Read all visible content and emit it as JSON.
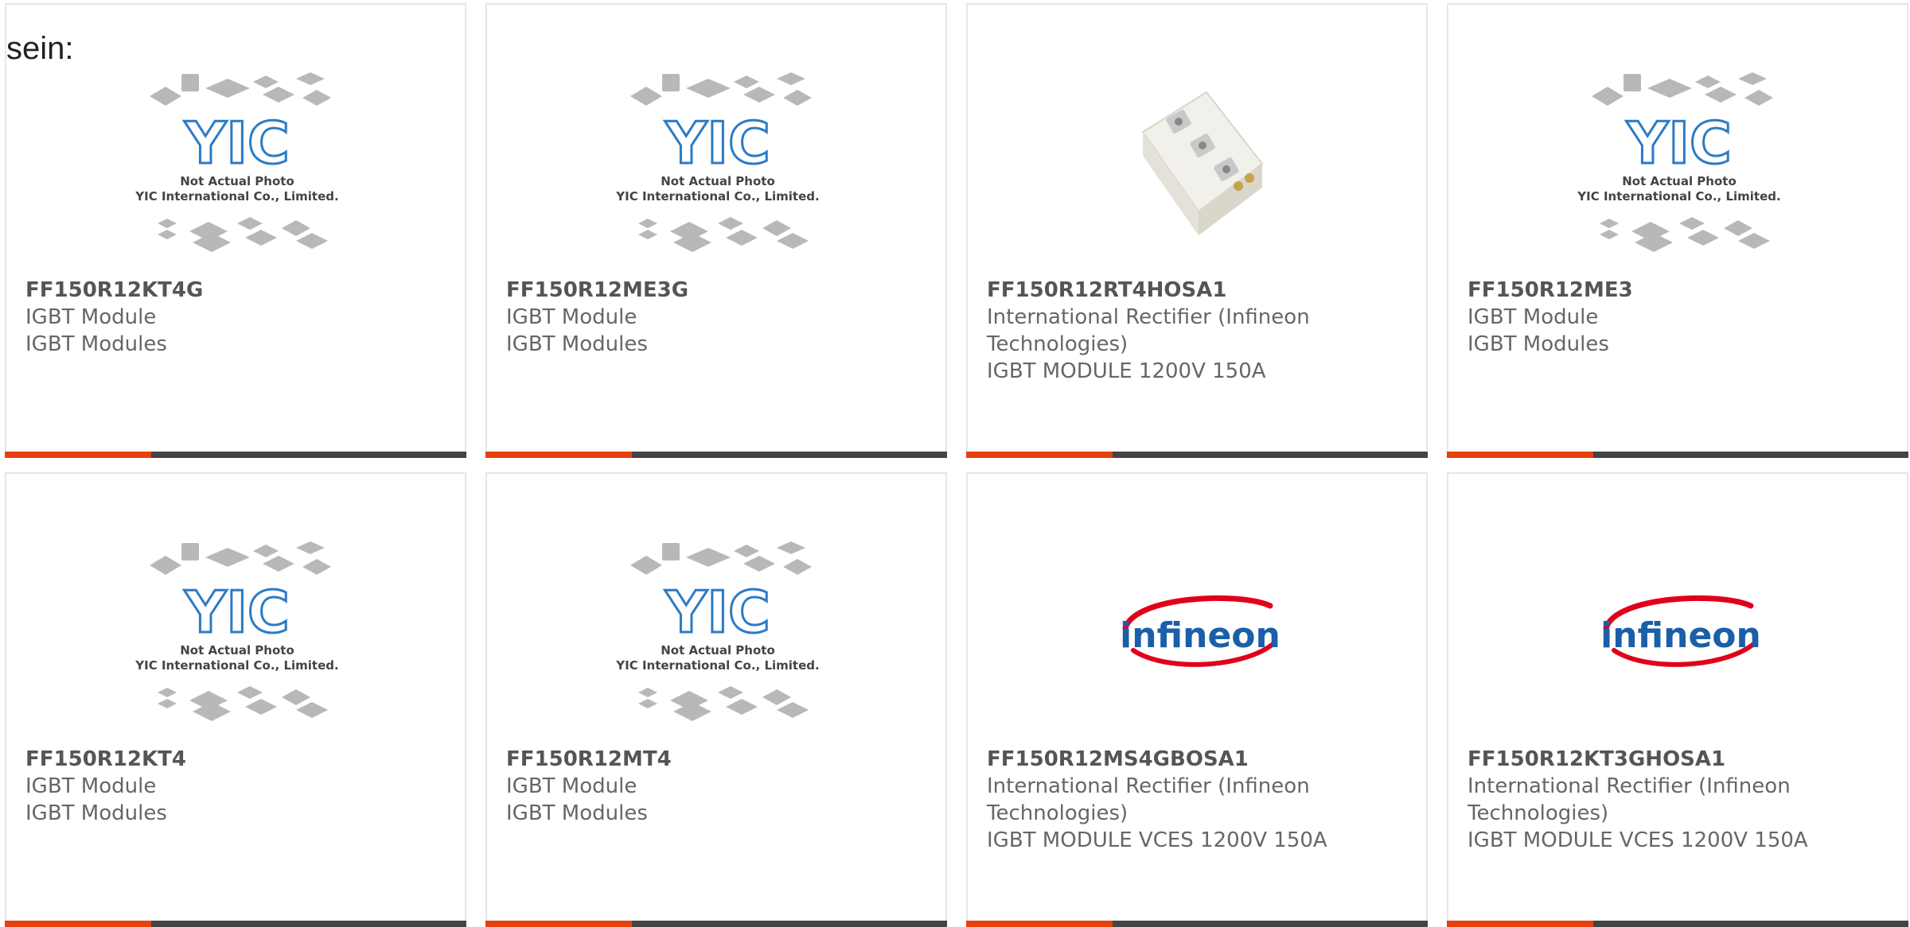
{
  "page": {
    "heading": "sein:"
  },
  "colors": {
    "accent": "#e8400f",
    "bar": "#444444",
    "part_number": "#555555",
    "text": "#666666",
    "yic_blue": "#2b7bc4",
    "infineon_red": "#e1001a",
    "infineon_blue": "#1a5fa8"
  },
  "placeholder_image": {
    "caption_line1": "Not Actual Photo",
    "caption_line2": "YIC International Co., Limited.",
    "logo_text": "YIC"
  },
  "infineon_logo": {
    "text": "infineon"
  },
  "products": [
    {
      "part_number": "FF150R12KT4G",
      "image": "yic-placeholder",
      "lines": [
        "IGBT Module",
        "IGBT Modules"
      ]
    },
    {
      "part_number": "FF150R12ME3G",
      "image": "yic-placeholder",
      "lines": [
        "IGBT Module",
        "IGBT Modules"
      ]
    },
    {
      "part_number": "FF150R12RT4HOSA1",
      "image": "igbt-module-photo",
      "lines": [
        "International Rectifier (Infineon",
        "Technologies)",
        "IGBT MODULE 1200V 150A"
      ]
    },
    {
      "part_number": "FF150R12ME3",
      "image": "yic-placeholder",
      "lines": [
        "IGBT Module",
        "IGBT Modules"
      ]
    },
    {
      "part_number": "FF150R12KT4",
      "image": "yic-placeholder",
      "lines": [
        "IGBT Module",
        "IGBT Modules"
      ]
    },
    {
      "part_number": "FF150R12MT4",
      "image": "yic-placeholder",
      "lines": [
        "IGBT Module",
        "IGBT Modules"
      ]
    },
    {
      "part_number": "FF150R12MS4GBOSA1",
      "image": "infineon-logo",
      "lines": [
        "International Rectifier (Infineon",
        "Technologies)",
        "IGBT MODULE VCES 1200V 150A"
      ]
    },
    {
      "part_number": "FF150R12KT3GHOSA1",
      "image": "infineon-logo",
      "lines": [
        "International Rectifier (Infineon",
        "Technologies)",
        "IGBT MODULE VCES 1200V 150A"
      ]
    }
  ]
}
